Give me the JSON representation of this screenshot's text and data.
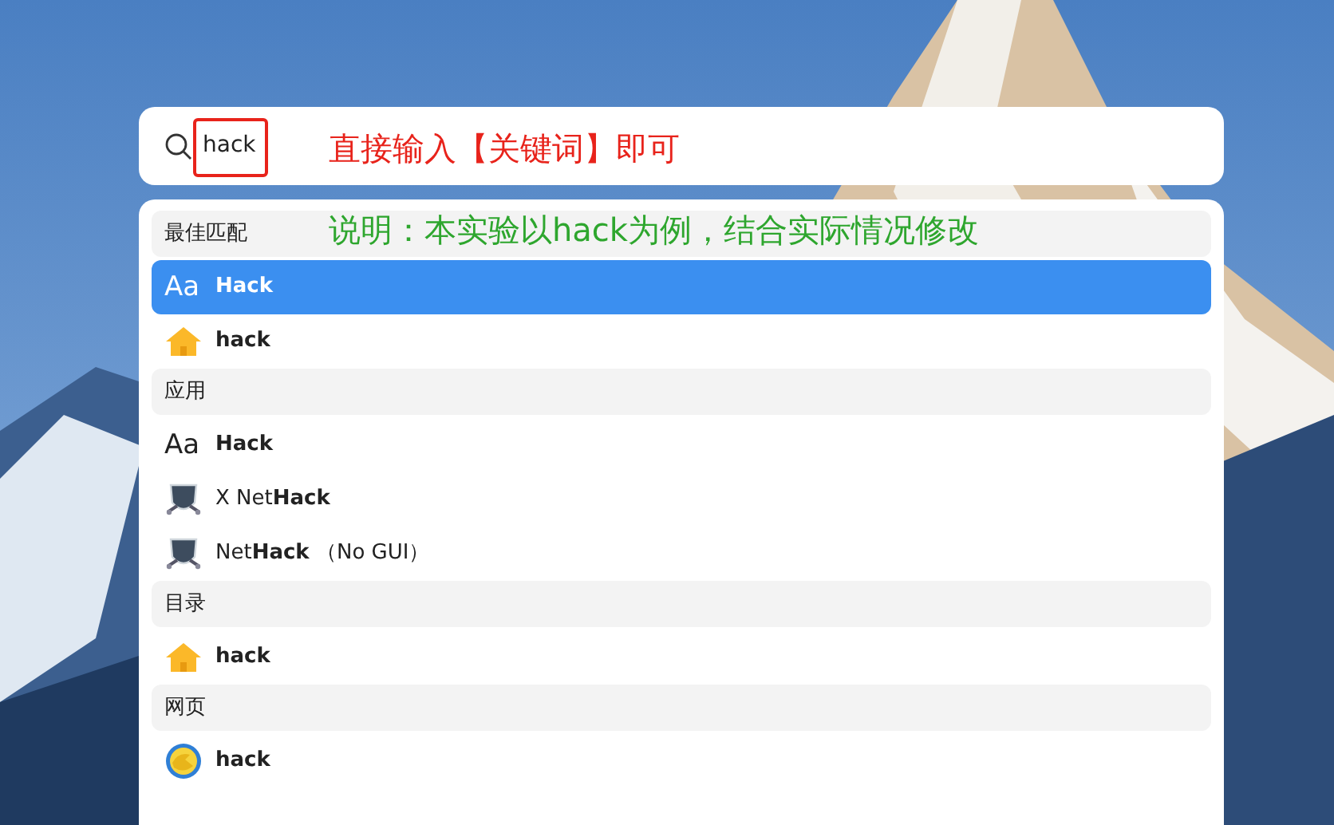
{
  "search": {
    "value": "hack"
  },
  "annotations": [
    {
      "kind": "box",
      "color": "#e8231b"
    },
    {
      "kind": "text",
      "text": "直接输入【关键词】即可",
      "color": "#e8231b"
    },
    {
      "kind": "text",
      "text": "说明：本实验以hack为例，结合实际情况修改",
      "color": "#2ea62e"
    }
  ],
  "results": [
    {
      "kind": "section",
      "label": "最佳匹配"
    },
    {
      "kind": "font",
      "icon_text": "Aa",
      "title": "Hack",
      "bold": true,
      "selected": true
    },
    {
      "kind": "folder",
      "title": "hack",
      "bold": true,
      "selected": false
    },
    {
      "kind": "section",
      "label": "应用"
    },
    {
      "kind": "font",
      "icon_text": "Aa",
      "title": "Hack",
      "bold": true,
      "selected": false
    },
    {
      "kind": "app",
      "title": "X Net**Hack**",
      "bold": false,
      "selected": false
    },
    {
      "kind": "app",
      "title": "Net**Hack** （No GUI）",
      "bold": false,
      "selected": false
    },
    {
      "kind": "section",
      "label": "目录"
    },
    {
      "kind": "folder",
      "title": "hack",
      "bold": true,
      "selected": false
    },
    {
      "kind": "section",
      "label": "网页"
    },
    {
      "kind": "web",
      "title": "hack",
      "bold": true,
      "selected": false
    }
  ]
}
